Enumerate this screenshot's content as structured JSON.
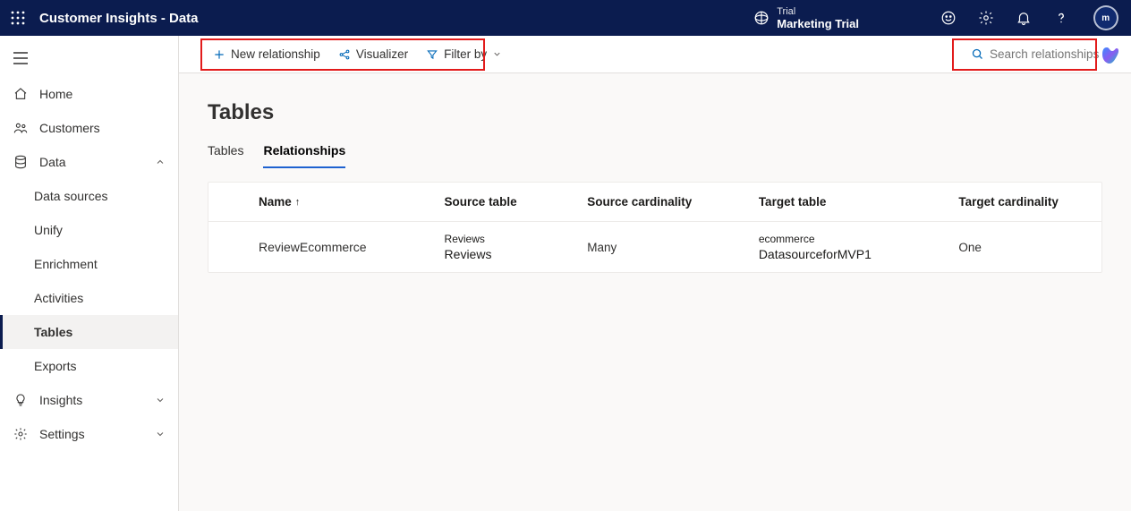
{
  "header": {
    "app_title": "Customer Insights - Data",
    "trial_label": "Trial",
    "trial_name": "Marketing Trial",
    "avatar_initials": "m"
  },
  "sidebar": {
    "home": "Home",
    "customers": "Customers",
    "data": "Data",
    "data_children": {
      "data_sources": "Data sources",
      "unify": "Unify",
      "enrichment": "Enrichment",
      "activities": "Activities",
      "tables": "Tables",
      "exports": "Exports"
    },
    "insights": "Insights",
    "settings": "Settings"
  },
  "commands": {
    "new_relationship": "New relationship",
    "visualizer": "Visualizer",
    "filter_by": "Filter by",
    "search_placeholder": "Search relationships"
  },
  "page": {
    "title": "Tables",
    "tabs": {
      "tables": "Tables",
      "relationships": "Relationships"
    }
  },
  "table": {
    "columns": {
      "name": "Name",
      "source_table": "Source table",
      "source_cardinality": "Source cardinality",
      "target_table": "Target table",
      "target_cardinality": "Target cardinality"
    },
    "rows": [
      {
        "name": "ReviewEcommerce",
        "source_minor": "Reviews",
        "source_major": "Reviews",
        "source_cardinality": "Many",
        "target_minor": "ecommerce",
        "target_major": "DatasourceforMVP1",
        "target_cardinality": "One"
      }
    ]
  }
}
